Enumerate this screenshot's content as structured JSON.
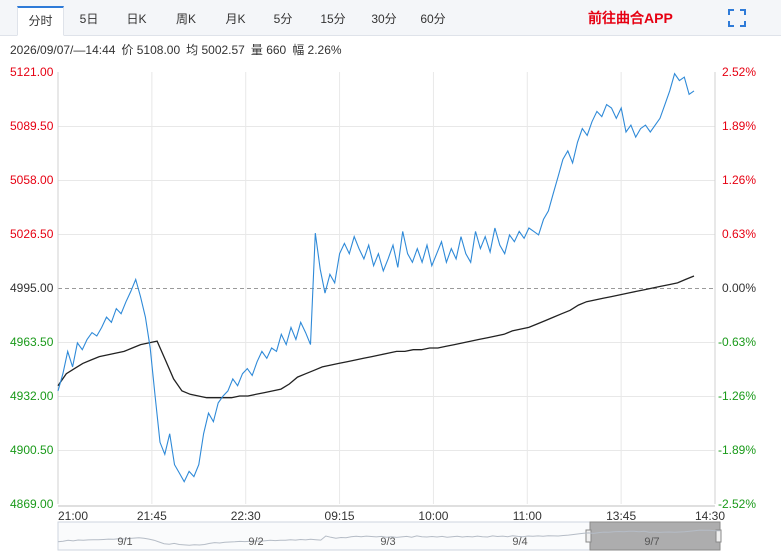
{
  "tabs": [
    {
      "label": "分时",
      "active": true
    },
    {
      "label": "5日",
      "active": false
    },
    {
      "label": "日K",
      "active": false
    },
    {
      "label": "周K",
      "active": false
    },
    {
      "label": "月K",
      "active": false
    },
    {
      "label": "5分",
      "active": false
    },
    {
      "label": "15分",
      "active": false
    },
    {
      "label": "30分",
      "active": false
    },
    {
      "label": "60分",
      "active": false
    }
  ],
  "app_link": "前往曲合APP",
  "info": {
    "datetime": "2026/09/07/—14:44",
    "price": "价 5108.00",
    "avg": "均 5002.57",
    "volume": "量 660",
    "amplitude": "幅 2.26%"
  },
  "colors": {
    "up": "#e60012",
    "down": "#1a9a1a",
    "neutral": "#333333",
    "price_line": "#2f8ad8",
    "avg_line": "#222222",
    "accent": "#2f7bd8"
  },
  "chart_data": {
    "type": "line",
    "reference": 4995,
    "ylim": [
      4869,
      5121
    ],
    "y_ticks": [
      {
        "label": "5121.00",
        "value": 5121,
        "kind": "up"
      },
      {
        "label": "5089.50",
        "value": 5089.5,
        "kind": "up"
      },
      {
        "label": "5058.00",
        "value": 5058,
        "kind": "up"
      },
      {
        "label": "5026.50",
        "value": 5026.5,
        "kind": "up"
      },
      {
        "label": "4995.00",
        "value": 4995,
        "kind": "neutral"
      },
      {
        "label": "4963.50",
        "value": 4963.5,
        "kind": "down"
      },
      {
        "label": "4932.00",
        "value": 4932,
        "kind": "down"
      },
      {
        "label": "4900.50",
        "value": 4900.5,
        "kind": "down"
      },
      {
        "label": "4869.00",
        "value": 4869,
        "kind": "down"
      }
    ],
    "pct_ticks": [
      "2.52%",
      "1.89%",
      "1.26%",
      "0.63%",
      "0.00%",
      "-0.63%",
      "-1.26%",
      "-1.89%",
      "-2.52%"
    ],
    "x_ticks": [
      "21:00",
      "21:45",
      "22:30",
      "09:15",
      "10:00",
      "11:00",
      "13:45",
      "14:30"
    ],
    "nav_labels": [
      "9/1",
      "9/2",
      "9/3",
      "9/4",
      "9/7"
    ],
    "series": [
      {
        "kind": "price",
        "values": [
          4935,
          4945,
          4958,
          4949,
          4963,
          4959,
          4965,
          4969,
          4967,
          4972,
          4978,
          4975,
          4983,
          4980,
          4987,
          4993,
          5000,
          4990,
          4978,
          4960,
          4932,
          4905,
          4898,
          4910,
          4892,
          4887,
          4882,
          4888,
          4885,
          4892,
          4910,
          4922,
          4917,
          4928,
          4932,
          4935,
          4942,
          4938,
          4945,
          4948,
          4944,
          4952,
          4958,
          4954,
          4960,
          4958,
          4968,
          4962,
          4972,
          4965,
          4975,
          4969,
          4962,
          5027,
          5006,
          4992,
          5003,
          4998,
          5015,
          5021,
          5015,
          5025,
          5018,
          5012,
          5020,
          5008,
          5015,
          5005,
          5012,
          5020,
          5007,
          5028,
          5015,
          5010,
          5018,
          5010,
          5020,
          5008,
          5015,
          5022,
          5010,
          5018,
          5012,
          5025,
          5015,
          5010,
          5028,
          5018,
          5025,
          5016,
          5030,
          5020,
          5015,
          5026,
          5022,
          5028,
          5024,
          5030,
          5028,
          5026,
          5035,
          5040,
          5050,
          5060,
          5070,
          5075,
          5068,
          5080,
          5088,
          5084,
          5092,
          5098,
          5095,
          5102,
          5100,
          5094,
          5100,
          5086,
          5090,
          5083,
          5088,
          5090,
          5086,
          5090,
          5094,
          5102,
          5110,
          5120,
          5116,
          5118,
          5108,
          5110
        ]
      },
      {
        "kind": "avg",
        "values": [
          4938,
          4945,
          4948,
          4951,
          4953,
          4955,
          4956,
          4957,
          4958,
          4960,
          4962,
          4963,
          4964,
          4953,
          4942,
          4935,
          4933,
          4932,
          4931,
          4931,
          4931,
          4931,
          4932,
          4932,
          4933,
          4934,
          4935,
          4936,
          4939,
          4943,
          4945,
          4947,
          4949,
          4950,
          4951,
          4952,
          4953,
          4954,
          4955,
          4956,
          4957,
          4958,
          4958,
          4959,
          4959,
          4960,
          4960,
          4961,
          4962,
          4963,
          4964,
          4965,
          4966,
          4967,
          4968,
          4970,
          4971,
          4972,
          4974,
          4976,
          4978,
          4980,
          4982,
          4985,
          4987,
          4988,
          4989,
          4990,
          4991,
          4992,
          4993,
          4994,
          4995,
          4996,
          4997,
          4998,
          5000,
          5002
        ]
      }
    ]
  }
}
